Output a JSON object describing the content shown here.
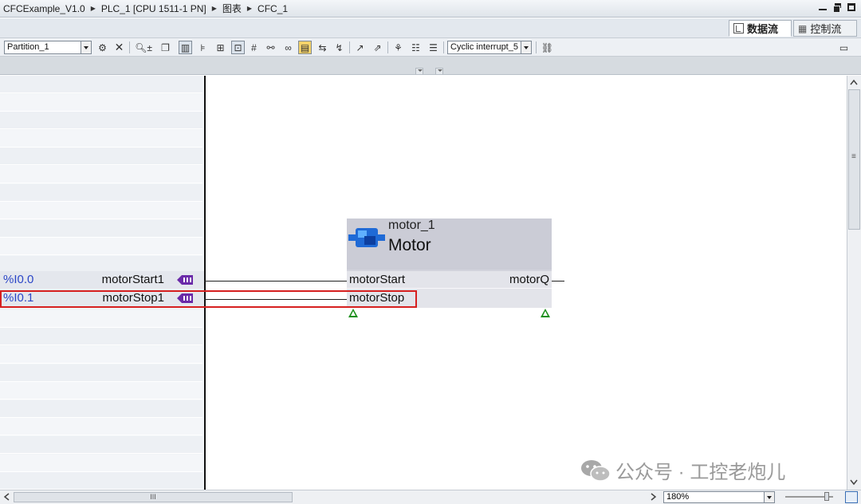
{
  "breadcrumb": [
    "CFCExample_V1.0",
    "PLC_1 [CPU 1511-1 PN]",
    "图表",
    "CFC_1"
  ],
  "view_tabs": {
    "dataflow": "数据流",
    "controlflow": "控制流"
  },
  "toolbar": {
    "partition": "Partition_1",
    "interrupt": "Cyclic interrupt_5"
  },
  "signals": [
    {
      "address": "%I0.0",
      "name": "motorStart1"
    },
    {
      "address": "%I0.1",
      "name": "motorStop1"
    }
  ],
  "block": {
    "instance": "motor_1",
    "type": "Motor",
    "inputs": [
      "motorStart",
      "motorStop"
    ],
    "outputs": [
      "motorQ"
    ]
  },
  "statusbar": {
    "zoom": "180%",
    "scroll_label": "III"
  },
  "watermark": {
    "text": "公众号 · 工控老炮儿"
  },
  "colors": {
    "address_text": "#2b46c7",
    "highlight": "#d62020",
    "en_triangle": "#1a8f1a"
  }
}
